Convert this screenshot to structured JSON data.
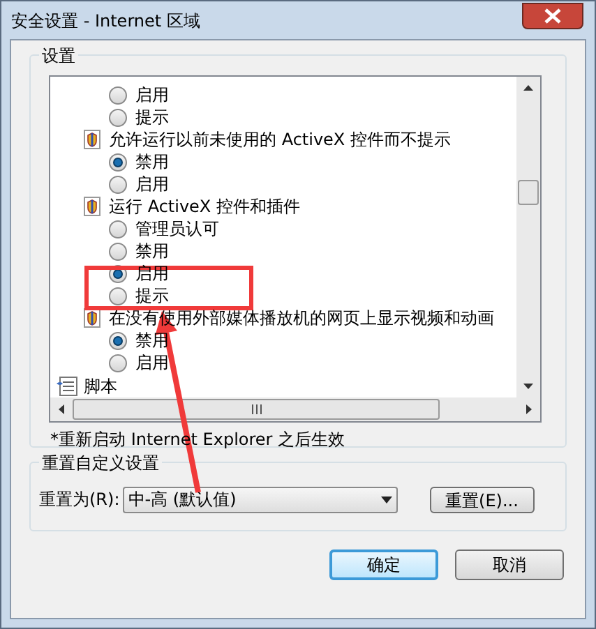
{
  "window": {
    "title": "安全设置 - Internet 区域"
  },
  "settings_group": {
    "title": "设置",
    "rows": [
      {
        "kind": "option",
        "label": "启用",
        "selected": false
      },
      {
        "kind": "option",
        "label": "提示",
        "selected": false
      },
      {
        "kind": "setting",
        "label": "允许运行以前未使用的 ActiveX 控件而不提示"
      },
      {
        "kind": "option",
        "label": "禁用",
        "selected": true
      },
      {
        "kind": "option",
        "label": "启用",
        "selected": false
      },
      {
        "kind": "setting",
        "label": "运行 ActiveX 控件和插件"
      },
      {
        "kind": "option",
        "label": "管理员认可",
        "selected": false
      },
      {
        "kind": "option",
        "label": "禁用",
        "selected": false
      },
      {
        "kind": "option",
        "label": "启用",
        "selected": true
      },
      {
        "kind": "option",
        "label": "提示",
        "selected": false
      },
      {
        "kind": "setting",
        "label": "在没有使用外部媒体播放机的网页上显示视频和动画"
      },
      {
        "kind": "option",
        "label": "禁用",
        "selected": true
      },
      {
        "kind": "option",
        "label": "启用",
        "selected": false
      },
      {
        "kind": "category",
        "label": "脚本"
      }
    ],
    "note": "*重新启动 Internet Explorer 之后生效"
  },
  "reset_group": {
    "title": "重置自定义设置",
    "label": "重置为(R):",
    "value": "中-高 (默认值)",
    "button": "重置(E)..."
  },
  "buttons": [
    {
      "label": "确定",
      "default": true
    },
    {
      "label": "取消",
      "default": false
    }
  ],
  "annotations": [
    {
      "kind": "box"
    },
    {
      "kind": "arrow"
    }
  ]
}
